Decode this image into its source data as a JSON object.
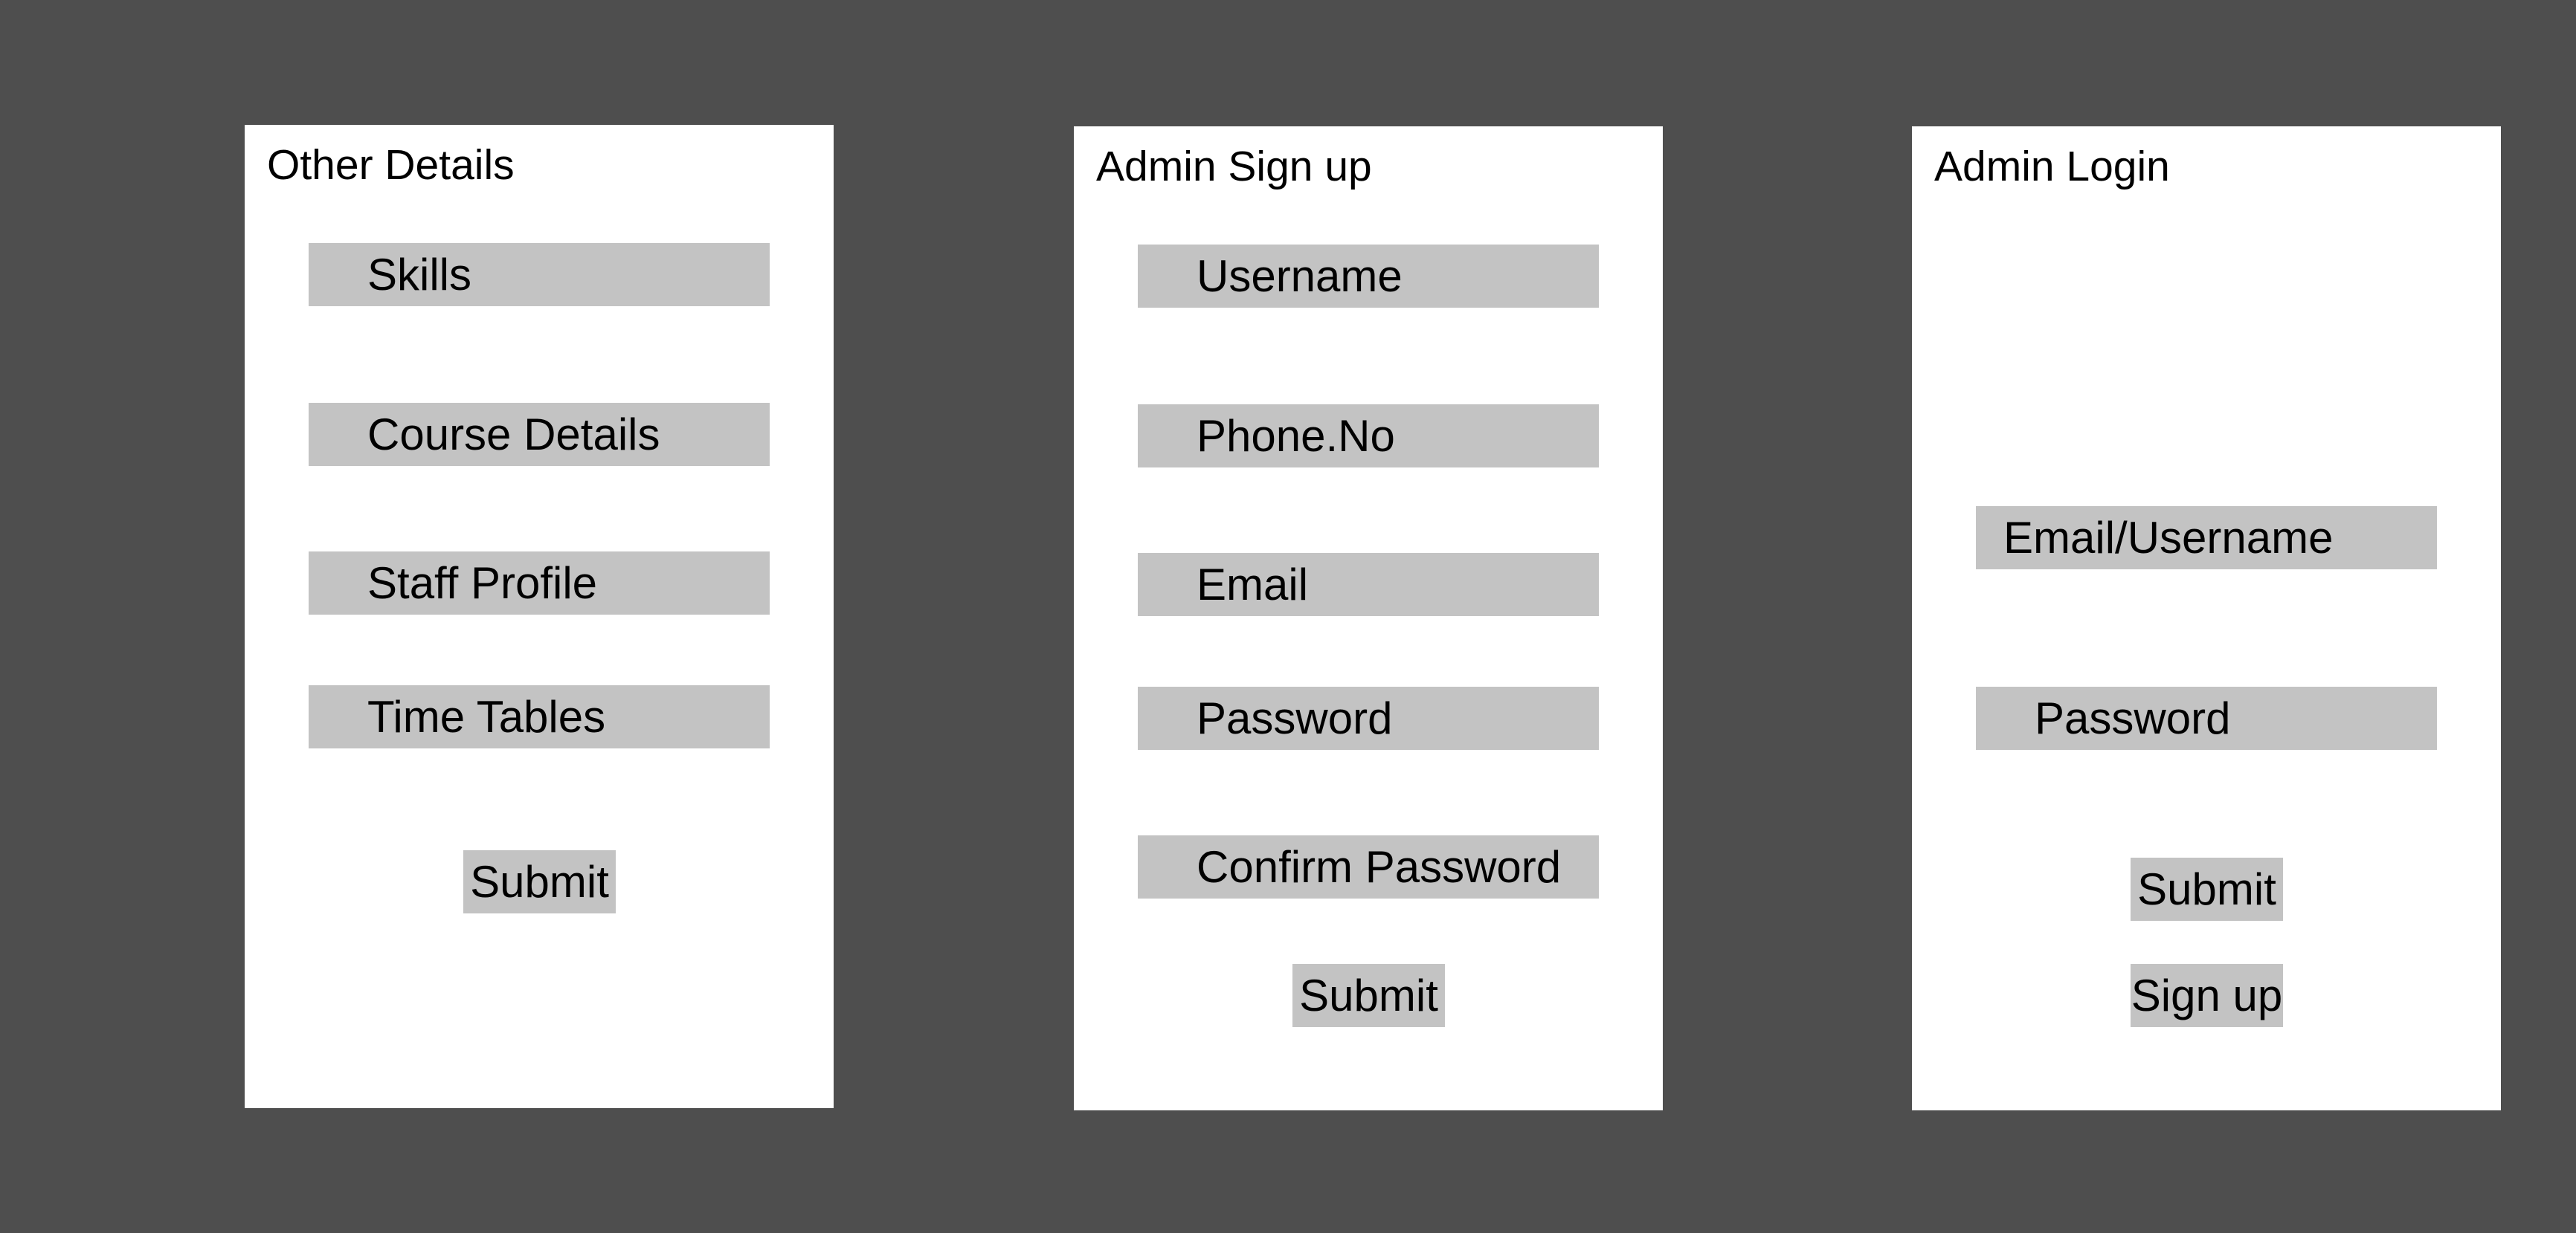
{
  "other_details": {
    "title": "Other Details",
    "fields": [
      "Skills",
      "Course Details",
      "Staff Profile",
      "Time Tables"
    ],
    "submit_label": "Submit"
  },
  "admin_signup": {
    "title": "Admin Sign up",
    "fields": [
      "Username",
      "Phone.No",
      "Email",
      "Password",
      "Confirm Password"
    ],
    "submit_label": "Submit"
  },
  "admin_login": {
    "title": "Admin Login",
    "fields": [
      "Email/Username",
      "Password"
    ],
    "submit_label": "Submit",
    "signup_label": "Sign up"
  }
}
